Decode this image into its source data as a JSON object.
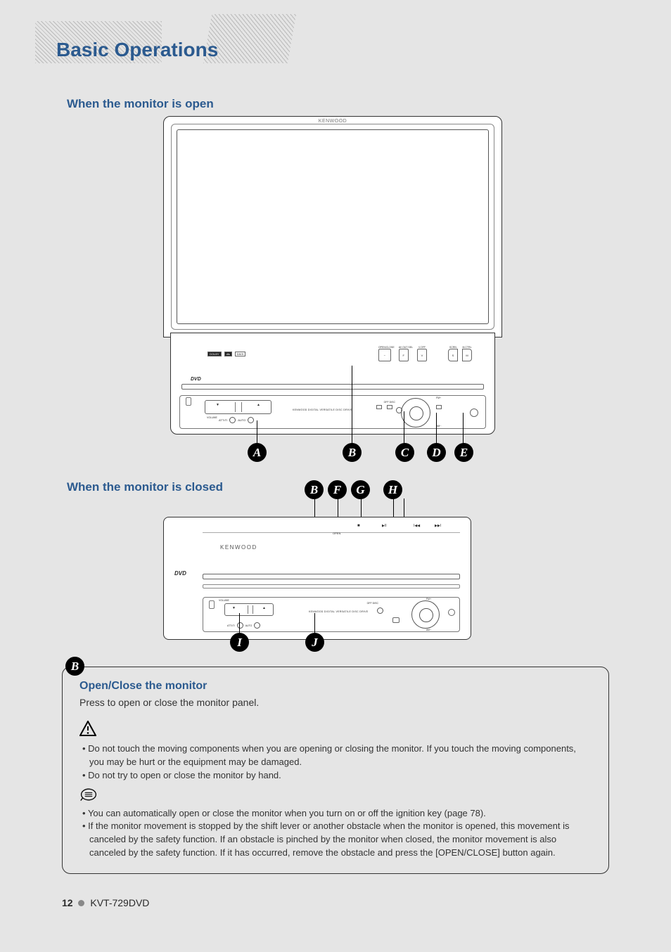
{
  "title": "Basic Operations",
  "sections": {
    "open": "When the monitor is open",
    "closed": "When the monitor is closed"
  },
  "brand": "KENWOOD",
  "dvd_logo": "DVD",
  "panel_buttons": {
    "open_close": "OPEN/CLOSE",
    "avout_sel": "AV OUT SEL",
    "voff": "V.OFF",
    "scrn": "SCRN",
    "mctrl": "M.CTRL",
    "f": "F",
    "v": "V",
    "s": "S",
    "m": "M"
  },
  "panel_labels": {
    "volume": "VOLUME",
    "att": "ATT•TI",
    "auto": "AUTO",
    "disc_off": "OFF DISC",
    "fm_plus": "FM+",
    "am_minus": "AM−",
    "drive_text": "KENWOOD DIGITAL VERSATILE DISC DRIVE"
  },
  "closed_panel": {
    "open_label": "OPEN"
  },
  "callouts": {
    "A": "A",
    "B": "B",
    "C": "C",
    "D": "D",
    "E": "E",
    "F": "F",
    "G": "G",
    "H": "H",
    "I": "I",
    "J": "J"
  },
  "instruction": {
    "tab": "B",
    "heading": "Open/Close the monitor",
    "body": "Press to open or close the monitor panel.",
    "warnings": [
      "Do not touch the moving components when you are opening or closing the monitor.  If you touch the moving components, you may be hurt or the equipment may be damaged.",
      "Do not try to open or close the monitor by hand."
    ],
    "notes": [
      "You can automatically open or close the monitor when you turn on or off the ignition key (page 78).",
      "If the monitor movement is stopped by the shift lever or another obstacle when the monitor is opened, this movement is canceled by the safety function. If an obstacle is pinched by the monitor when closed, the monitor movement is also canceled by the safety function. If it has occurred, remove the obstacle and press the [OPEN/CLOSE] button again."
    ]
  },
  "footer": {
    "page": "12",
    "model": "KVT-729DVD"
  }
}
